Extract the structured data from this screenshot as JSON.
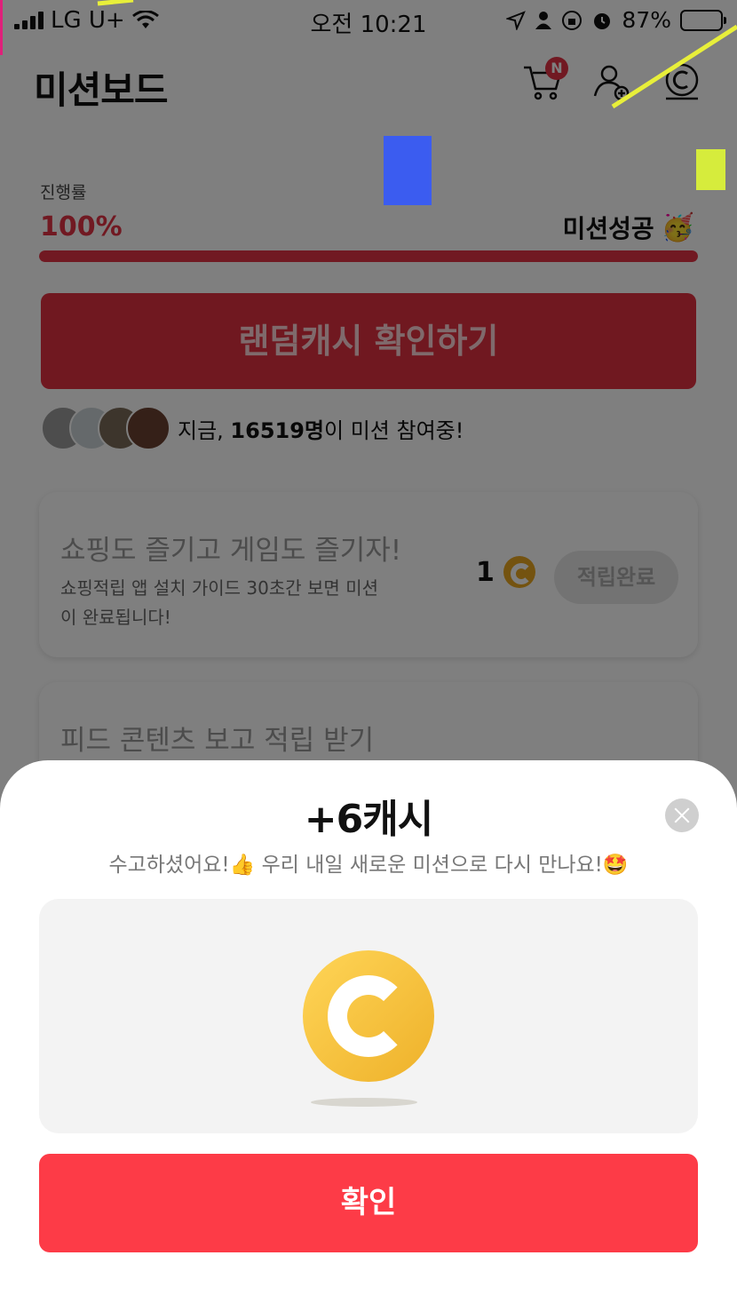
{
  "status_bar": {
    "carrier": "LG U+",
    "time": "오전 10:21",
    "battery": "87%",
    "battery_level": 0.87
  },
  "header": {
    "title": "미션보드",
    "cart_badge": "N"
  },
  "progress": {
    "label": "진행률",
    "value": "100%",
    "fraction": 1.0,
    "status": "미션성공",
    "status_emoji": "🥳"
  },
  "random_cash_button": "랜덤캐시 확인하기",
  "participants": {
    "prefix": "지금, ",
    "count": "16519명",
    "suffix": "이 미션 참여중!"
  },
  "missions": [
    {
      "title": "쇼핑도 즐기고 게임도 즐기자!",
      "description": "쇼핑적립 앱 설치 가이드 30초간 보면 미션이 완료됩니다!",
      "reward": "1",
      "button": "적립완료"
    },
    {
      "title": "피드 콘텐츠 보고 적립 받기"
    }
  ],
  "modal": {
    "title": "+6캐시",
    "subtitle": "수고하셨어요!👍 우리 내일 새로운 미션으로 다시 만나요!🤩",
    "confirm": "확인"
  },
  "colors": {
    "accent": "#fd3b47",
    "coin": "#f5c037"
  }
}
